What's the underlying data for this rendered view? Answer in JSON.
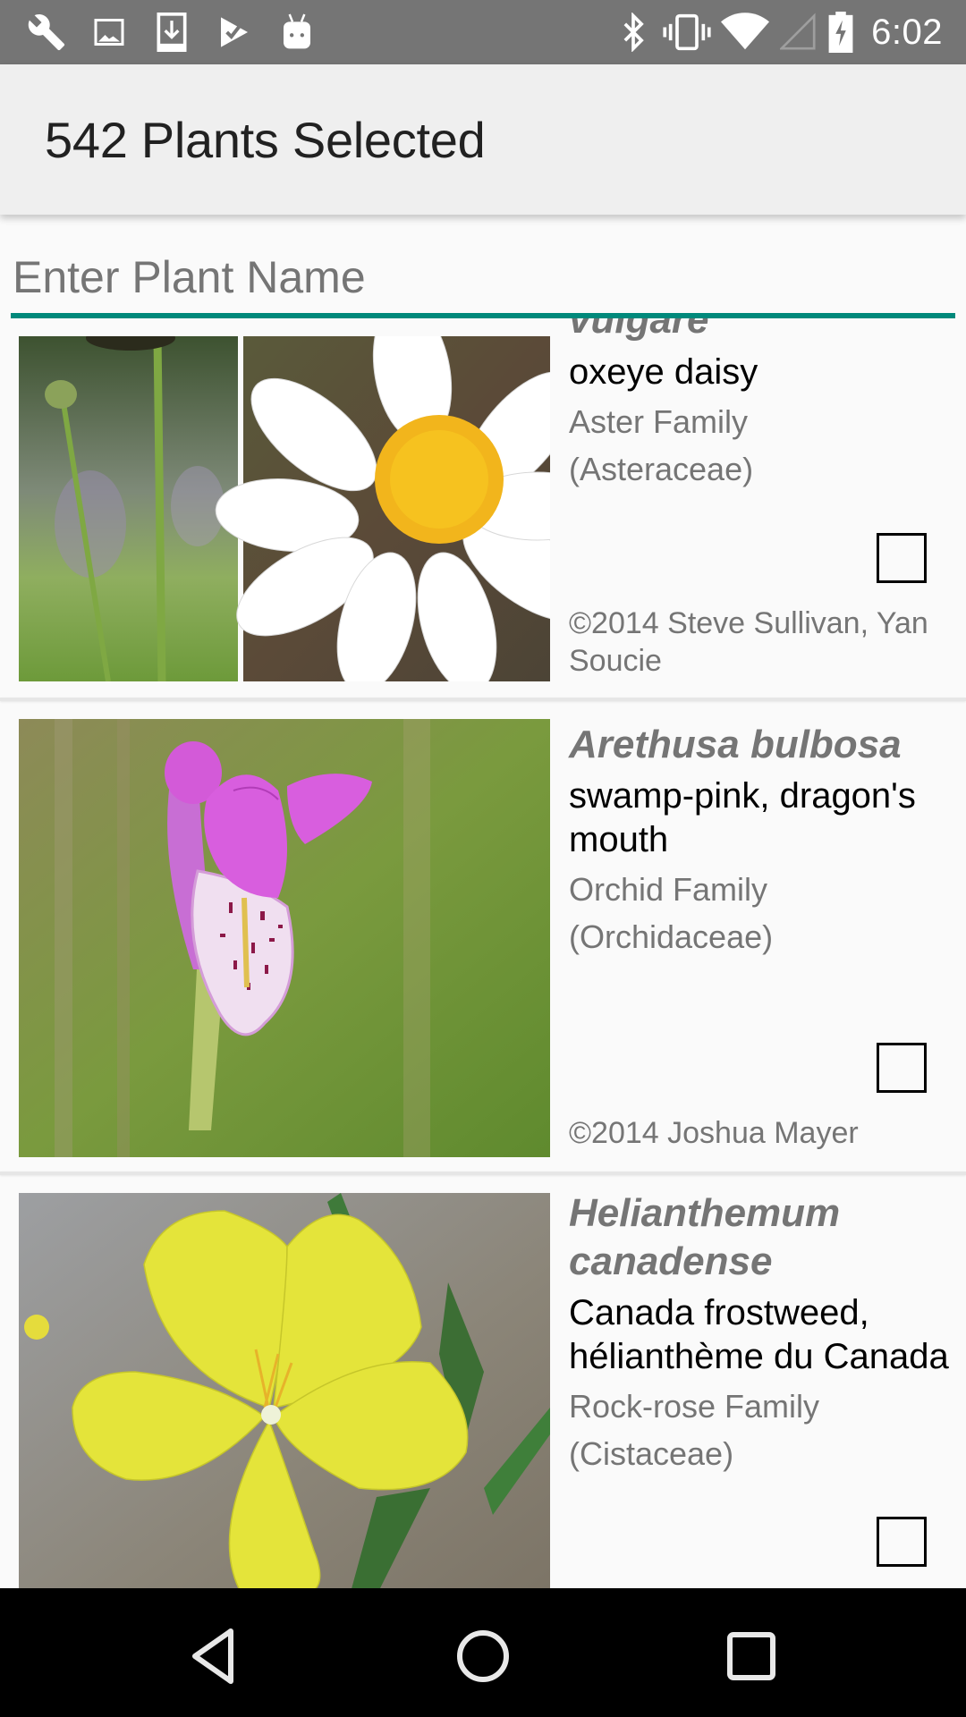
{
  "status_bar": {
    "left_icons": [
      "wrench-icon",
      "image-icon",
      "download-icon",
      "play-store-check-icon",
      "android-icon"
    ],
    "right_icons": [
      "bluetooth-icon",
      "vibrate-icon",
      "wifi-icon",
      "cell-signal-icon",
      "battery-charging-icon"
    ],
    "time": "6:02"
  },
  "app_bar": {
    "title": "542 Plants Selected"
  },
  "search": {
    "value": "",
    "placeholder": "Enter Plant Name",
    "accent_color": "#00897b"
  },
  "plants": [
    {
      "scientific_name_partial": "vulgare",
      "common_name": "oxeye daisy",
      "family_line1": "Aster Family",
      "family_line2": "(Asteraceae)",
      "copyright": "©2014 Steve Sullivan, Yan Soucie",
      "checked": false,
      "image": "oxeye-daisy-photo"
    },
    {
      "scientific_name": "Arethusa bulbosa",
      "common_name": "swamp-pink, dragon's mouth",
      "family_line1": "Orchid Family",
      "family_line2": "(Orchidaceae)",
      "copyright": "©2014 Joshua Mayer",
      "checked": false,
      "image": "swamp-pink-orchid-photo"
    },
    {
      "scientific_name": "Helianthemum canadense",
      "common_name": "Canada frostweed, hélianthème du Canada",
      "family_line1": "Rock-rose Family",
      "family_line2": "(Cistaceae)",
      "copyright": "",
      "checked": false,
      "image": "canada-frostweed-photo"
    }
  ],
  "nav_bar": {
    "buttons": [
      "back",
      "home",
      "recents"
    ]
  }
}
